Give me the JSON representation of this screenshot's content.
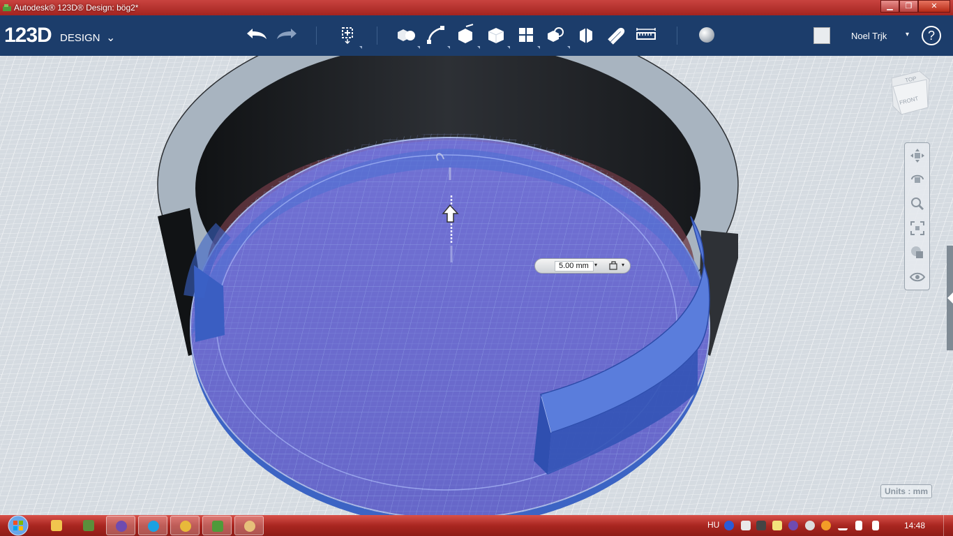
{
  "window": {
    "title": "Autodesk® 123D® Design: bög2*",
    "minimize": "▁",
    "maximize": "❐",
    "close": "✕"
  },
  "toolbar": {
    "logo_num": "123D",
    "logo_word": "DESIGN",
    "logo_chevron": "⌄",
    "buttons": [
      "undo",
      "redo",
      "transform",
      "primitives",
      "sketch",
      "construct",
      "modify",
      "pattern",
      "grouping",
      "combine",
      "measure-tool",
      "snap",
      "ruler",
      "material"
    ],
    "user_name": "Noel Trjk",
    "user_chevron": "▾",
    "help": "?"
  },
  "viewport": {
    "viewcube_top": "TOP",
    "viewcube_front": "FRONT",
    "dimension_value": "5.00 mm",
    "dimension_dropdown": "▾",
    "units_label": "Units : mm",
    "accent_color": "#5b7fd6"
  },
  "taskbar": {
    "language": "HU",
    "clock": "14:48",
    "apps": [
      "file-explorer",
      "minecraft",
      "browser-c",
      "skype",
      "chrome",
      "123d-design",
      "paint"
    ]
  }
}
